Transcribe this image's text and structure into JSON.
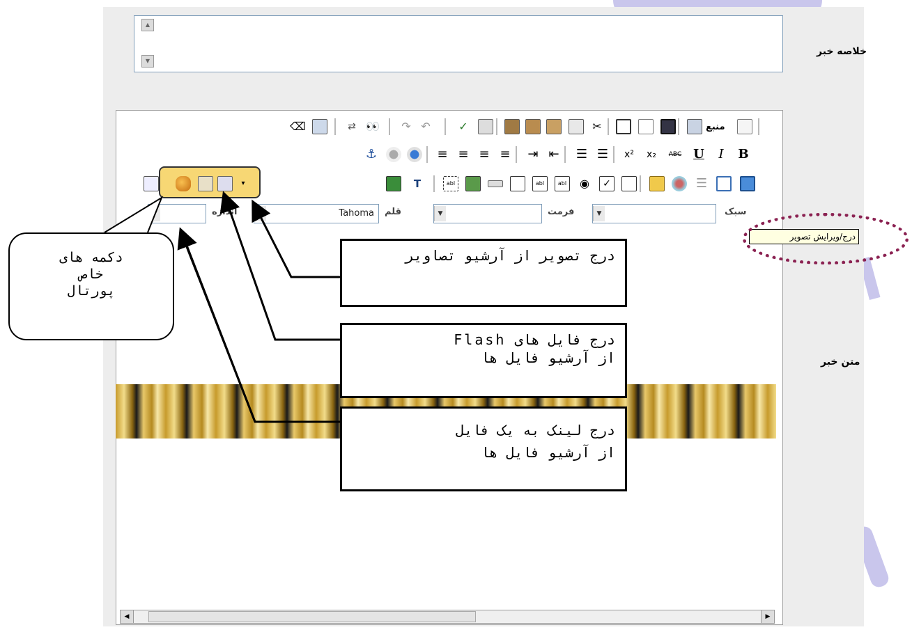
{
  "form": {
    "summary_label": "خلاصه خبر",
    "body_label": "متن خبر"
  },
  "toolbar": {
    "style_label": "سبک",
    "format_label": "فرمت",
    "font_label": "قلم",
    "font_value": "Tahoma",
    "size_label": "اندازه",
    "source_label": "منبع"
  },
  "tooltip": {
    "text": "درج/ویرایش تصویر"
  },
  "callouts": {
    "insert_image": "درج تصویر از آرشیو تصاویر",
    "insert_flash_line1": "درج فایل های Flash",
    "insert_flash_line2": "از آرشیو فایل ها",
    "insert_link_line1": "درج لینک به یک فایل",
    "insert_link_line2": "از آرشیو فایل ها",
    "portal_buttons_line1": "دکمه های",
    "portal_buttons_line2": "خاص",
    "portal_buttons_line3": "پورتال"
  },
  "colors": {
    "highlight": "#f7d774",
    "dotted_circle": "#8b2252",
    "lavender": "#c9c6ec"
  }
}
